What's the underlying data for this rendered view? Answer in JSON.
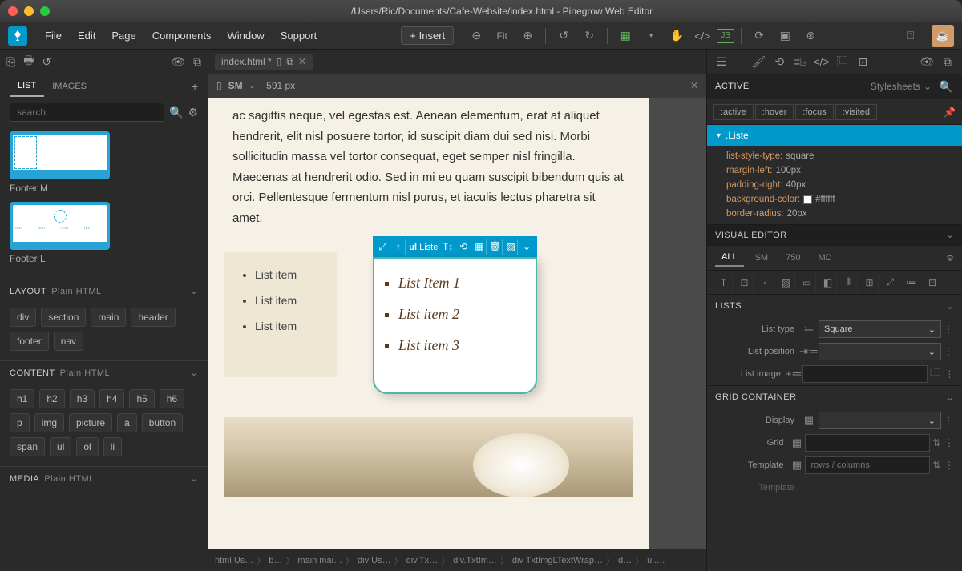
{
  "title": "/Users/Ric/Documents/Cafe-Website/index.html - Pinegrow Web Editor",
  "menu": {
    "items": [
      "File",
      "Edit",
      "Page",
      "Components",
      "Window",
      "Support"
    ],
    "insert": "Insert",
    "fit": "Fit"
  },
  "leftPanel": {
    "tabs": [
      "LIST",
      "IMAGES"
    ],
    "searchPlaceholder": "search",
    "thumbs": [
      "Footer M",
      "Footer L"
    ],
    "layout": {
      "title": "LAYOUT",
      "sub": "Plain HTML",
      "items": [
        "div",
        "section",
        "main",
        "header",
        "footer",
        "nav"
      ]
    },
    "content": {
      "title": "CONTENT",
      "sub": "Plain HTML",
      "items": [
        "h1",
        "h2",
        "h3",
        "h4",
        "h5",
        "h6",
        "p",
        "img",
        "picture",
        "a",
        "button",
        "span",
        "ul",
        "ol",
        "li"
      ]
    },
    "media": {
      "title": "MEDIA",
      "sub": "Plain HTML"
    }
  },
  "document": {
    "tabName": "index.html *",
    "breakpoint": "SM",
    "width": "591 px",
    "lorem": "ac sagittis neque, vel egestas est. Aenean elementum, erat at aliquet hendrerit, elit nisl posuere tortor, id suscipit diam dui sed nisi. Morbi sollicitudin massa vel tortor consequat, eget semper nisl fringilla. Maecenas at hendrerit odio. Sed in mi eu quam suscipit bibendum quis at orci. Pellentesque fermentum nisl purus, et iaculis lectus pharetra sit amet.",
    "plainItems": [
      "List item",
      "List item",
      "List item"
    ],
    "selectedTag": "ul",
    "selectedClass": ".Liste",
    "styledItems": [
      "List Item 1",
      "List item 2",
      "List item 3"
    ]
  },
  "breadcrumbs": [
    "html Us…",
    "b…",
    "main mai…",
    "div Us…",
    "div.Tx…",
    "div.TxtIm…",
    "div TxtImgLTextWrap…",
    "d…",
    "ul.…"
  ],
  "rightPanel": {
    "active": "ACTIVE",
    "stylesheets": "Stylesheets",
    "pseudo": [
      ":active",
      ":hover",
      ":focus",
      ":visited"
    ],
    "selector": ".Liste",
    "rules": [
      {
        "prop": "list-style-type",
        "val": "square"
      },
      {
        "prop": "margin-left",
        "val": "100px"
      },
      {
        "prop": "padding-right",
        "val": "40px"
      },
      {
        "prop": "background-color",
        "val": "#ffffff",
        "swatch": true
      },
      {
        "prop": "border-radius",
        "val": "20px"
      }
    ],
    "visualEditor": "VISUAL EDITOR",
    "breakpoints": [
      "ALL",
      "SM",
      "750",
      "MD"
    ],
    "lists": {
      "title": "LISTS",
      "listType": {
        "label": "List type",
        "value": "Square"
      },
      "listPosition": {
        "label": "List position",
        "value": ""
      },
      "listImage": {
        "label": "List image",
        "value": ""
      }
    },
    "grid": {
      "title": "GRID CONTAINER",
      "display": {
        "label": "Display",
        "value": ""
      },
      "grid": {
        "label": "Grid",
        "value": ""
      },
      "template": {
        "label": "Template",
        "placeholder": "rows / columns"
      },
      "template2": {
        "label": "Template"
      }
    }
  }
}
